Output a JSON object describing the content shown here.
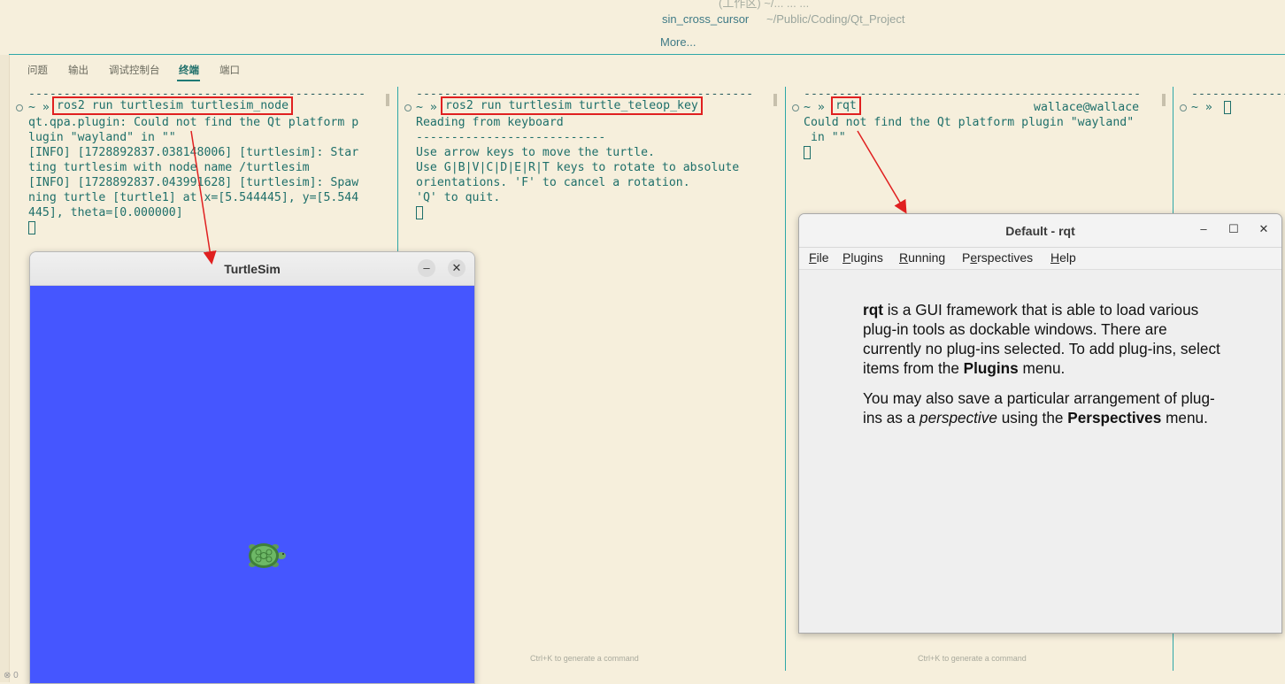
{
  "top": {
    "cut_text": "(工作区)  ~/...  ...  ...",
    "recent_name": "sin_cross_cursor",
    "recent_path": "~/Public/Coding/Qt_Project",
    "more": "More..."
  },
  "tabs": [
    {
      "label": "问题"
    },
    {
      "label": "输出"
    },
    {
      "label": "调试控制台"
    },
    {
      "label": "终端"
    },
    {
      "label": "端口"
    }
  ],
  "terminals": [
    {
      "prompt": "~ »",
      "command": "ros2 run turtlesim turtlesim_node",
      "lines": [
        "qt.qpa.plugin: Could not find the Qt platform p",
        "lugin \"wayland\" in \"\"",
        "[INFO] [1728892837.038148006] [turtlesim]: Star",
        "ting turtlesim with node name /turtlesim",
        "[INFO] [1728892837.043991628] [turtlesim]: Spaw",
        "ning turtle [turtle1] at x=[5.544445], y=[5.544",
        "445], theta=[0.000000]"
      ]
    },
    {
      "prompt": "~ »",
      "command": "ros2 run turtlesim turtle_teleop_key",
      "lines": [
        "Reading from keyboard",
        "---------------------------",
        "Use arrow keys to move the turtle.",
        "Use G|B|V|C|D|E|R|T keys to rotate to absolute",
        "orientations. 'F' to cancel a rotation.",
        "'Q' to quit."
      ]
    },
    {
      "prompt": "~ »",
      "command": "rqt",
      "user_host": "wallace@wallace",
      "lines": [
        "Could not find the Qt platform plugin \"wayland\"",
        " in \"\""
      ]
    },
    {
      "prompt": "~ »"
    }
  ],
  "hints": {
    "generate": "Ctrl+K to generate a command"
  },
  "turtlesim": {
    "title": "TurtleSim",
    "minimize": "–",
    "close": "✕",
    "background": "#4556ff"
  },
  "rqt": {
    "title": "Default - rqt",
    "minimize": "–",
    "maximize": "☐",
    "close": "✕",
    "menus": [
      "File",
      "Plugins",
      "Running",
      "Perspectives",
      "Help"
    ],
    "menu_mnemonics": [
      "F",
      "P",
      "R",
      "e",
      "H"
    ]
  },
  "status": {
    "left": "⊗ 0"
  },
  "colors": {
    "accent": "#2ea7a7",
    "annotation": "#e02020",
    "terminal_text": "#1e6f6a"
  }
}
